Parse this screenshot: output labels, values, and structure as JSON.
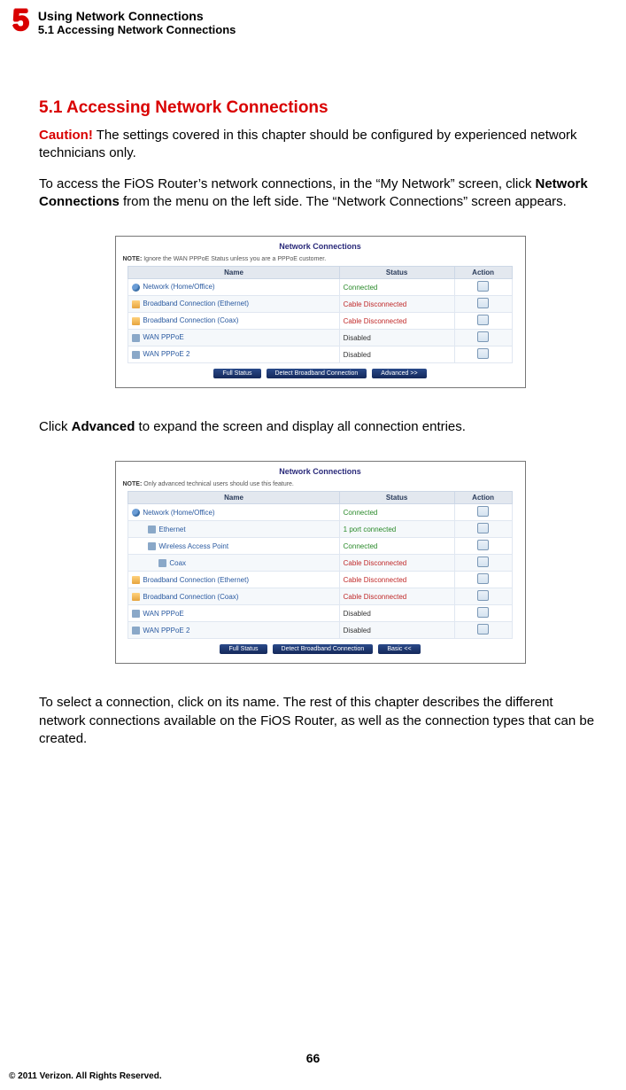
{
  "header": {
    "chapter_number": "5",
    "chapter_title": "Using Network Connections",
    "chapter_subtitle": "5.1  Accessing Network Connections"
  },
  "content": {
    "section_heading": "5.1  Accessing Network Connections",
    "caution_word": "Caution!",
    "caution_text": " The settings covered in this chapter should be configured by experienced network technicians only.",
    "intro_a": "To access the FiOS Router’s network connections, in the “My Network” screen, click ",
    "intro_bold": "Network Connections",
    "intro_b": " from the menu on the left side. The “Network Connections” screen appears.",
    "advanced_a": "Click ",
    "advanced_bold": "Advanced",
    "advanced_b": " to expand the screen and display all connection entries.",
    "closing": "To select a connection, click on its name. The rest of this chapter describes the different network connections available on the FiOS Router, as well as the connection types that can be created."
  },
  "panel1": {
    "title": "Network Connections",
    "note_label": "NOTE:",
    "note_text": " Ignore the WAN PPPoE Status unless you are a PPPoE customer.",
    "headers": {
      "name": "Name",
      "status": "Status",
      "action": "Action"
    },
    "rows": [
      {
        "icon": "ic-net",
        "indent": "",
        "name": "Network (Home/Office)",
        "status": "Connected",
        "status_class": "status-green"
      },
      {
        "icon": "ic-conn",
        "indent": "",
        "name": "Broadband Connection (Ethernet)",
        "status": "Cable Disconnected",
        "status_class": "status-red"
      },
      {
        "icon": "ic-conn",
        "indent": "",
        "name": "Broadband Connection (Coax)",
        "status": "Cable Disconnected",
        "status_class": "status-red"
      },
      {
        "icon": "ic-dev",
        "indent": "",
        "name": "WAN PPPoE",
        "status": "Disabled",
        "status_class": "status-dis"
      },
      {
        "icon": "ic-dev",
        "indent": "",
        "name": "WAN PPPoE 2",
        "status": "Disabled",
        "status_class": "status-dis"
      }
    ],
    "buttons": [
      "Full Status",
      "Detect Broadband Connection",
      "Advanced >>"
    ]
  },
  "panel2": {
    "title": "Network Connections",
    "note_label": "NOTE:",
    "note_text": " Only advanced technical users should use this feature.",
    "headers": {
      "name": "Name",
      "status": "Status",
      "action": "Action"
    },
    "rows": [
      {
        "icon": "ic-net",
        "indent": "",
        "name": "Network (Home/Office)",
        "status": "Connected",
        "status_class": "status-green"
      },
      {
        "icon": "ic-dev",
        "indent": "indent-1",
        "name": "Ethernet",
        "status": "1 port connected",
        "status_class": "status-green"
      },
      {
        "icon": "ic-dev",
        "indent": "indent-1",
        "name": "Wireless Access Point",
        "status": "Connected",
        "status_class": "status-green"
      },
      {
        "icon": "ic-dev",
        "indent": "indent-2",
        "name": "Coax",
        "status": "Cable Disconnected",
        "status_class": "status-red"
      },
      {
        "icon": "ic-conn",
        "indent": "",
        "name": "Broadband Connection (Ethernet)",
        "status": "Cable Disconnected",
        "status_class": "status-red"
      },
      {
        "icon": "ic-conn",
        "indent": "",
        "name": "Broadband Connection (Coax)",
        "status": "Cable Disconnected",
        "status_class": "status-red"
      },
      {
        "icon": "ic-dev",
        "indent": "",
        "name": "WAN PPPoE",
        "status": "Disabled",
        "status_class": "status-dis"
      },
      {
        "icon": "ic-dev",
        "indent": "",
        "name": "WAN PPPoE 2",
        "status": "Disabled",
        "status_class": "status-dis"
      }
    ],
    "buttons": [
      "Full Status",
      "Detect Broadband Connection",
      "Basic <<"
    ]
  },
  "footer": {
    "page_number": "66",
    "copyright": "© 2011 Verizon. All Rights Reserved."
  }
}
